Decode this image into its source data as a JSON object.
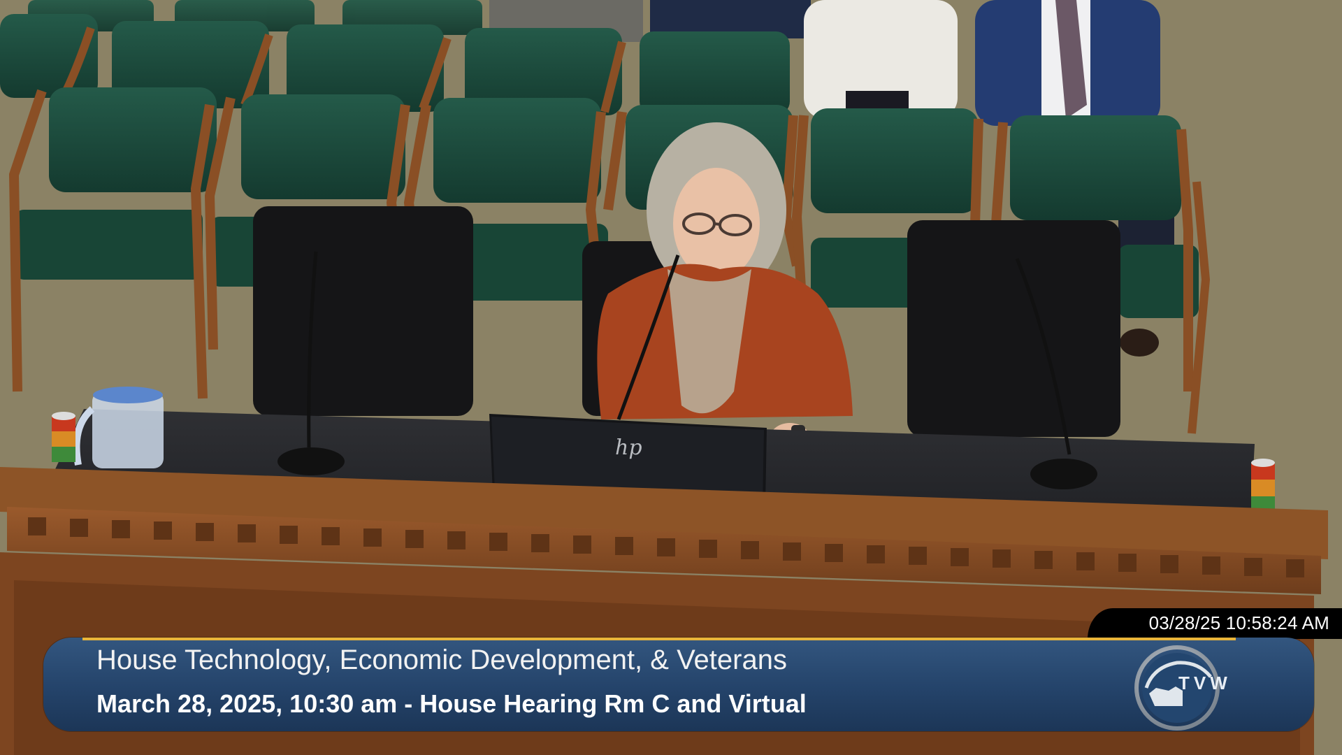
{
  "broadcast": {
    "timestamp": "03/28/25 10:58:24 AM",
    "title": "House Technology, Economic Development, & Veterans",
    "subtitle": "March 28, 2025, 10:30 am - House Hearing Rm C and Virtual",
    "logo_text": "TVW",
    "laptop_logo": "hp"
  },
  "colors": {
    "banner": "#26466d",
    "banner_accent": "#e9b53a",
    "chair_seat": "#1c4a3c",
    "wood": "#8a4f25",
    "cardigan": "#a8441f"
  }
}
